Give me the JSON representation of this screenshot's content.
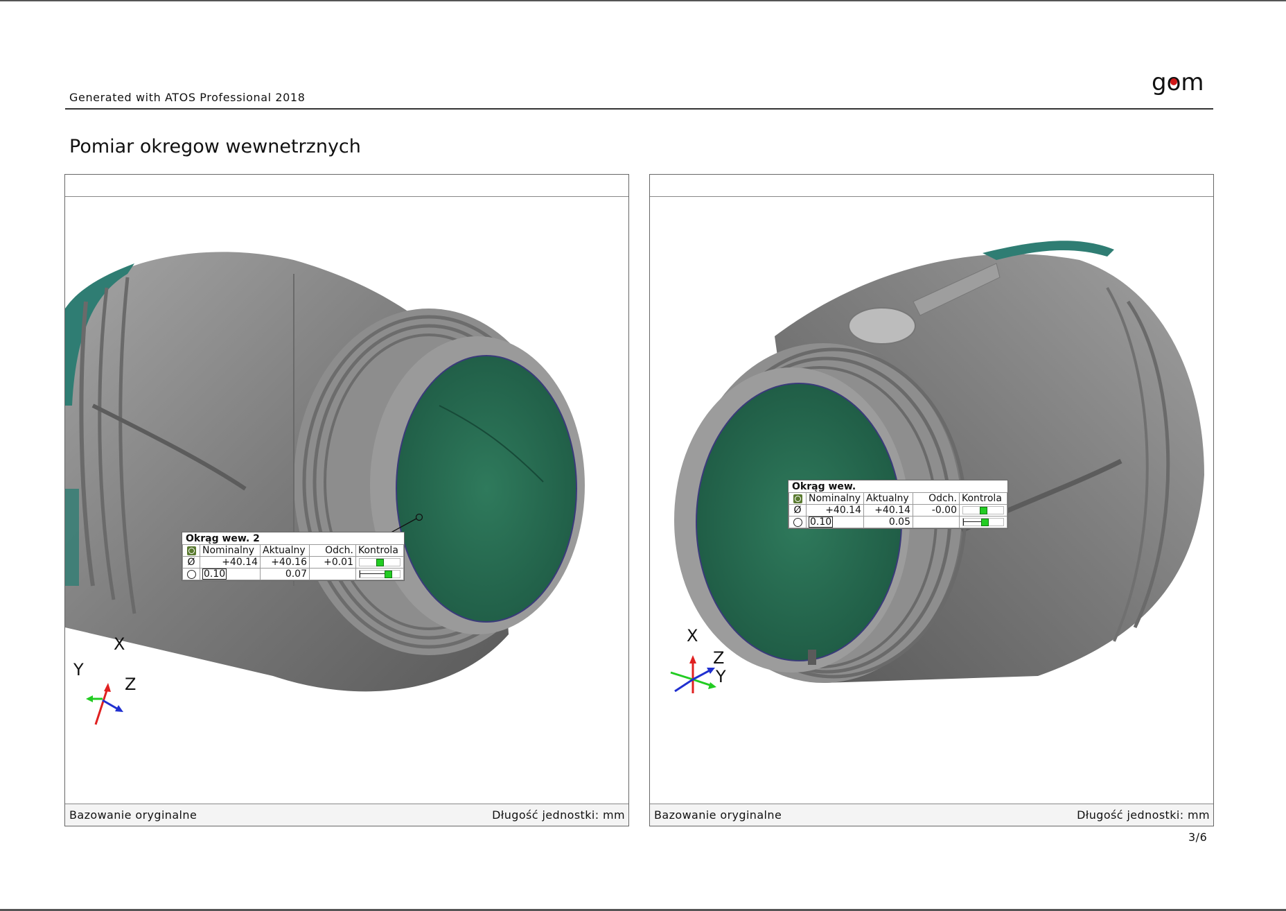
{
  "header": {
    "generated_text": "Generated with ATOS Professional 2018",
    "logo_text": "gom"
  },
  "page_title": "Pomiar okregow wewnetrznych",
  "panels": [
    {
      "footer_left": "Bazowanie oryginalne",
      "footer_right": "Długość jednostki: mm",
      "label": {
        "title": "Okrąg wew. 2",
        "columns": [
          "Nominalny",
          "Aktualny",
          "Odch.",
          "Kontrola"
        ],
        "diameter_symbol": "Ø",
        "diameter_row": {
          "nominal": "+40.14",
          "actual": "+40.16",
          "deviation": "+0.01"
        },
        "roundness_row": {
          "tolerance": "0.10",
          "actual": "0.07",
          "deviation": ""
        }
      },
      "axes": {
        "x": "X",
        "y": "Y",
        "z": "Z"
      }
    },
    {
      "footer_left": "Bazowanie oryginalne",
      "footer_right": "Długość jednostki: mm",
      "label": {
        "title": "Okrąg  wew.",
        "columns": [
          "Nominalny",
          "Aktualny",
          "Odch.",
          "Kontrola"
        ],
        "diameter_symbol": "Ø",
        "diameter_row": {
          "nominal": "+40.14",
          "actual": "+40.14",
          "deviation": "-0.00"
        },
        "roundness_row": {
          "tolerance": "0.10",
          "actual": "0.05",
          "deviation": ""
        }
      },
      "axes": {
        "x": "X",
        "y": "Y",
        "z": "Z"
      }
    }
  ],
  "page_number": "3/6",
  "colors": {
    "part_gray": "#8a8a8a",
    "inner_green": "#2e7d5e",
    "check_green": "#22cc22"
  }
}
